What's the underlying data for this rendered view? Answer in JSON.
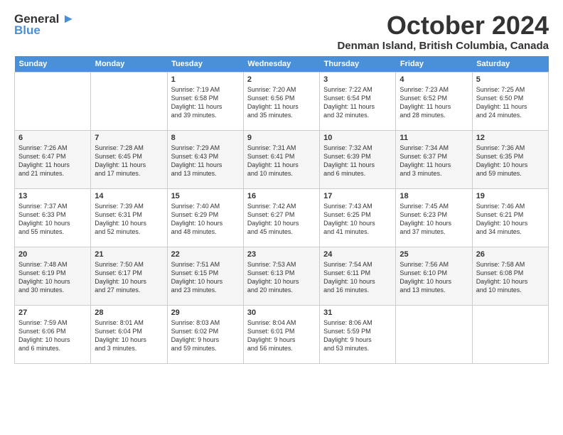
{
  "logo": {
    "general": "General",
    "blue": "Blue"
  },
  "title": "October 2024",
  "location": "Denman Island, British Columbia, Canada",
  "weekdays": [
    "Sunday",
    "Monday",
    "Tuesday",
    "Wednesday",
    "Thursday",
    "Friday",
    "Saturday"
  ],
  "weeks": [
    [
      {
        "day": "",
        "sunrise": "",
        "sunset": "",
        "daylight": ""
      },
      {
        "day": "",
        "sunrise": "",
        "sunset": "",
        "daylight": ""
      },
      {
        "day": "1",
        "sunrise": "Sunrise: 7:19 AM",
        "sunset": "Sunset: 6:58 PM",
        "daylight": "Daylight: 11 hours and 39 minutes."
      },
      {
        "day": "2",
        "sunrise": "Sunrise: 7:20 AM",
        "sunset": "Sunset: 6:56 PM",
        "daylight": "Daylight: 11 hours and 35 minutes."
      },
      {
        "day": "3",
        "sunrise": "Sunrise: 7:22 AM",
        "sunset": "Sunset: 6:54 PM",
        "daylight": "Daylight: 11 hours and 32 minutes."
      },
      {
        "day": "4",
        "sunrise": "Sunrise: 7:23 AM",
        "sunset": "Sunset: 6:52 PM",
        "daylight": "Daylight: 11 hours and 28 minutes."
      },
      {
        "day": "5",
        "sunrise": "Sunrise: 7:25 AM",
        "sunset": "Sunset: 6:50 PM",
        "daylight": "Daylight: 11 hours and 24 minutes."
      }
    ],
    [
      {
        "day": "6",
        "sunrise": "Sunrise: 7:26 AM",
        "sunset": "Sunset: 6:47 PM",
        "daylight": "Daylight: 11 hours and 21 minutes."
      },
      {
        "day": "7",
        "sunrise": "Sunrise: 7:28 AM",
        "sunset": "Sunset: 6:45 PM",
        "daylight": "Daylight: 11 hours and 17 minutes."
      },
      {
        "day": "8",
        "sunrise": "Sunrise: 7:29 AM",
        "sunset": "Sunset: 6:43 PM",
        "daylight": "Daylight: 11 hours and 13 minutes."
      },
      {
        "day": "9",
        "sunrise": "Sunrise: 7:31 AM",
        "sunset": "Sunset: 6:41 PM",
        "daylight": "Daylight: 11 hours and 10 minutes."
      },
      {
        "day": "10",
        "sunrise": "Sunrise: 7:32 AM",
        "sunset": "Sunset: 6:39 PM",
        "daylight": "Daylight: 11 hours and 6 minutes."
      },
      {
        "day": "11",
        "sunrise": "Sunrise: 7:34 AM",
        "sunset": "Sunset: 6:37 PM",
        "daylight": "Daylight: 11 hours and 3 minutes."
      },
      {
        "day": "12",
        "sunrise": "Sunrise: 7:36 AM",
        "sunset": "Sunset: 6:35 PM",
        "daylight": "Daylight: 10 hours and 59 minutes."
      }
    ],
    [
      {
        "day": "13",
        "sunrise": "Sunrise: 7:37 AM",
        "sunset": "Sunset: 6:33 PM",
        "daylight": "Daylight: 10 hours and 55 minutes."
      },
      {
        "day": "14",
        "sunrise": "Sunrise: 7:39 AM",
        "sunset": "Sunset: 6:31 PM",
        "daylight": "Daylight: 10 hours and 52 minutes."
      },
      {
        "day": "15",
        "sunrise": "Sunrise: 7:40 AM",
        "sunset": "Sunset: 6:29 PM",
        "daylight": "Daylight: 10 hours and 48 minutes."
      },
      {
        "day": "16",
        "sunrise": "Sunrise: 7:42 AM",
        "sunset": "Sunset: 6:27 PM",
        "daylight": "Daylight: 10 hours and 45 minutes."
      },
      {
        "day": "17",
        "sunrise": "Sunrise: 7:43 AM",
        "sunset": "Sunset: 6:25 PM",
        "daylight": "Daylight: 10 hours and 41 minutes."
      },
      {
        "day": "18",
        "sunrise": "Sunrise: 7:45 AM",
        "sunset": "Sunset: 6:23 PM",
        "daylight": "Daylight: 10 hours and 37 minutes."
      },
      {
        "day": "19",
        "sunrise": "Sunrise: 7:46 AM",
        "sunset": "Sunset: 6:21 PM",
        "daylight": "Daylight: 10 hours and 34 minutes."
      }
    ],
    [
      {
        "day": "20",
        "sunrise": "Sunrise: 7:48 AM",
        "sunset": "Sunset: 6:19 PM",
        "daylight": "Daylight: 10 hours and 30 minutes."
      },
      {
        "day": "21",
        "sunrise": "Sunrise: 7:50 AM",
        "sunset": "Sunset: 6:17 PM",
        "daylight": "Daylight: 10 hours and 27 minutes."
      },
      {
        "day": "22",
        "sunrise": "Sunrise: 7:51 AM",
        "sunset": "Sunset: 6:15 PM",
        "daylight": "Daylight: 10 hours and 23 minutes."
      },
      {
        "day": "23",
        "sunrise": "Sunrise: 7:53 AM",
        "sunset": "Sunset: 6:13 PM",
        "daylight": "Daylight: 10 hours and 20 minutes."
      },
      {
        "day": "24",
        "sunrise": "Sunrise: 7:54 AM",
        "sunset": "Sunset: 6:11 PM",
        "daylight": "Daylight: 10 hours and 16 minutes."
      },
      {
        "day": "25",
        "sunrise": "Sunrise: 7:56 AM",
        "sunset": "Sunset: 6:10 PM",
        "daylight": "Daylight: 10 hours and 13 minutes."
      },
      {
        "day": "26",
        "sunrise": "Sunrise: 7:58 AM",
        "sunset": "Sunset: 6:08 PM",
        "daylight": "Daylight: 10 hours and 10 minutes."
      }
    ],
    [
      {
        "day": "27",
        "sunrise": "Sunrise: 7:59 AM",
        "sunset": "Sunset: 6:06 PM",
        "daylight": "Daylight: 10 hours and 6 minutes."
      },
      {
        "day": "28",
        "sunrise": "Sunrise: 8:01 AM",
        "sunset": "Sunset: 6:04 PM",
        "daylight": "Daylight: 10 hours and 3 minutes."
      },
      {
        "day": "29",
        "sunrise": "Sunrise: 8:03 AM",
        "sunset": "Sunset: 6:02 PM",
        "daylight": "Daylight: 9 hours and 59 minutes."
      },
      {
        "day": "30",
        "sunrise": "Sunrise: 8:04 AM",
        "sunset": "Sunset: 6:01 PM",
        "daylight": "Daylight: 9 hours and 56 minutes."
      },
      {
        "day": "31",
        "sunrise": "Sunrise: 8:06 AM",
        "sunset": "Sunset: 5:59 PM",
        "daylight": "Daylight: 9 hours and 53 minutes."
      },
      {
        "day": "",
        "sunrise": "",
        "sunset": "",
        "daylight": ""
      },
      {
        "day": "",
        "sunrise": "",
        "sunset": "",
        "daylight": ""
      }
    ]
  ]
}
